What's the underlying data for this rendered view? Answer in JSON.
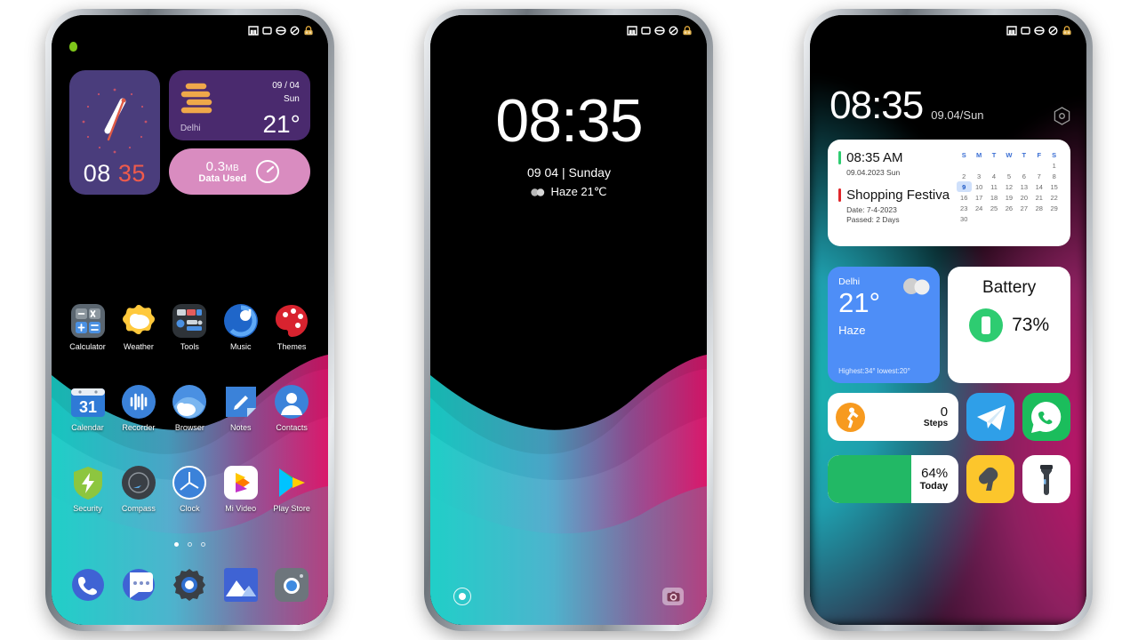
{
  "statusbar": {
    "icons": [
      "signal-icon",
      "wifi-icon",
      "battery-icon",
      "sync-icon",
      "lock-icon"
    ]
  },
  "phone1": {
    "name": "home-screen",
    "clock_widget": {
      "hours": "08",
      "minutes": "35"
    },
    "weather_widget": {
      "date": "09 / 04",
      "day": "Sun",
      "city": "Delhi",
      "temp": "21°"
    },
    "data_widget": {
      "amount": "0.3",
      "unit": "MB",
      "label": "Data Used"
    },
    "apps_row1": [
      {
        "label": "Calculator",
        "icon": "calculator-icon"
      },
      {
        "label": "Weather",
        "icon": "weather-icon"
      },
      {
        "label": "Tools",
        "icon": "tools-icon"
      },
      {
        "label": "Music",
        "icon": "music-icon"
      },
      {
        "label": "Themes",
        "icon": "themes-icon"
      }
    ],
    "apps_row2": [
      {
        "label": "Calendar",
        "icon": "calendar-icon"
      },
      {
        "label": "Recorder",
        "icon": "recorder-icon"
      },
      {
        "label": "Browser",
        "icon": "browser-icon"
      },
      {
        "label": "Notes",
        "icon": "notes-icon"
      },
      {
        "label": "Contacts",
        "icon": "contacts-icon"
      }
    ],
    "apps_row3": [
      {
        "label": "Security",
        "icon": "security-icon"
      },
      {
        "label": "Compass",
        "icon": "compass-icon"
      },
      {
        "label": "Clock",
        "icon": "clock-icon"
      },
      {
        "label": "Mi Video",
        "icon": "mi-video-icon"
      },
      {
        "label": "Play Store",
        "icon": "play-store-icon"
      }
    ],
    "dock": [
      {
        "icon": "phone-icon"
      },
      {
        "icon": "messages-icon"
      },
      {
        "icon": "settings-icon"
      },
      {
        "icon": "gallery-icon"
      },
      {
        "icon": "camera-icon"
      }
    ],
    "page_dots": {
      "count": 3,
      "active": 1
    }
  },
  "phone2": {
    "name": "lock-screen",
    "time": "08:35",
    "date": "09 04 | Sunday",
    "weather": "Haze 21℃",
    "shortcuts": {
      "left": "voice-assistant-icon",
      "right": "camera-icon"
    }
  },
  "phone3": {
    "name": "widget-screen",
    "time": "08:35",
    "date": "09.04/Sun",
    "settings_icon": "hex-gear-icon",
    "calendar_card": {
      "alarm_time": "08:35 AM",
      "alarm_date": "09.04.2023 Sun",
      "event_title": "Shopping Festiva",
      "event_date": "Date: 7-4-2023",
      "event_passed": "Passed:  2 Days",
      "weekdays": [
        "S",
        "M",
        "T",
        "W",
        "T",
        "F",
        "S"
      ],
      "weeks": [
        [
          "",
          "",
          "",
          "",
          "",
          "",
          "1"
        ],
        [
          "2",
          "3",
          "4",
          "5",
          "6",
          "7",
          "8"
        ],
        [
          "9",
          "10",
          "11",
          "12",
          "13",
          "14",
          "15"
        ],
        [
          "16",
          "17",
          "18",
          "19",
          "20",
          "21",
          "22"
        ],
        [
          "23",
          "24",
          "25",
          "26",
          "27",
          "28",
          "29"
        ],
        [
          "30",
          "",
          "",
          "",
          "",
          "",
          ""
        ]
      ],
      "selected_day": "9"
    },
    "weather_widget": {
      "city": "Delhi",
      "temp": "21°",
      "condition": "Haze",
      "range": "Highest:34° lowest:20°"
    },
    "battery_widget": {
      "title": "Battery",
      "percent": "73%"
    },
    "steps_widget": {
      "value": "0",
      "label": "Steps"
    },
    "storage_widget": {
      "percent": "64%",
      "label": "Today",
      "fill": 64
    },
    "apps": [
      {
        "name": "telegram-icon",
        "color": "#2f9fe8"
      },
      {
        "name": "whatsapp-icon",
        "color": "#1bbd5c"
      },
      {
        "name": "notes-yellow-icon",
        "color": "#fcc62c"
      },
      {
        "name": "flashlight-icon",
        "color": "#ffffff"
      }
    ]
  },
  "colors": {
    "clock_widget_bg": "#4a3d7c",
    "weather_widget_bg": "#4a2a6e",
    "data_widget_bg": "#d98cc0",
    "accent_red": "#ef5b4c",
    "weather_blue": "#4e8ef7",
    "battery_green": "#22b865",
    "steps_orange": "#f79a1f",
    "calendar_blue": "#3b6fd4"
  }
}
